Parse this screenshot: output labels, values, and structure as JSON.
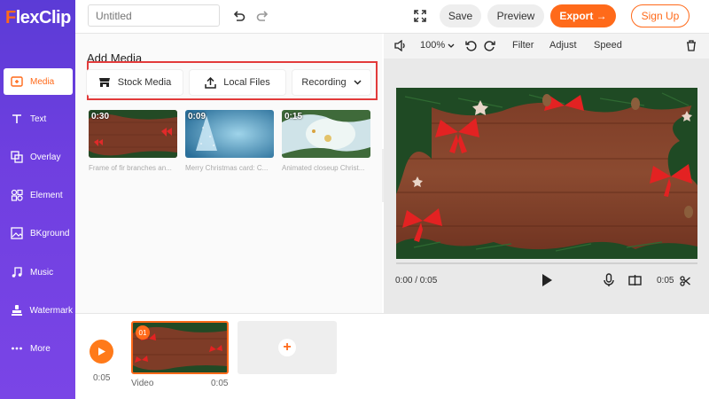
{
  "app": {
    "logo": "FlexClip"
  },
  "sidebar": {
    "items": [
      {
        "label": "Media",
        "icon": "media-icon",
        "active": true
      },
      {
        "label": "Text",
        "icon": "text-icon"
      },
      {
        "label": "Overlay",
        "icon": "overlay-icon"
      },
      {
        "label": "Element",
        "icon": "element-icon"
      },
      {
        "label": "BKground",
        "icon": "background-icon"
      },
      {
        "label": "Music",
        "icon": "music-icon"
      },
      {
        "label": "Watermark",
        "icon": "watermark-icon"
      },
      {
        "label": "More",
        "icon": "more-icon"
      }
    ]
  },
  "topbar": {
    "title_placeholder": "Untitled",
    "save": "Save",
    "preview": "Preview",
    "export": "Export →",
    "signup": "Sign Up"
  },
  "panel": {
    "title": "Add Media",
    "sources": {
      "stock": "Stock Media",
      "local": "Local Files",
      "recording": "Recording"
    },
    "thumbs": [
      {
        "duration": "0:30",
        "caption": "Frame of fir branches an..."
      },
      {
        "duration": "0:09",
        "caption": "Merry Christmas card: C..."
      },
      {
        "duration": "0:15",
        "caption": "Animated closeup Christ..."
      }
    ]
  },
  "preview": {
    "zoom": "100%",
    "filter": "Filter",
    "adjust": "Adjust",
    "speed": "Speed",
    "time_current": "0:00 / 0:05",
    "duration": "0:05"
  },
  "timeline": {
    "total_time": "0:05",
    "clip_number": "01",
    "clip_label": "Video",
    "clip_duration": "0:05"
  },
  "colors": {
    "accent": "#ff6a1a",
    "sidebar": "#6a3fe0",
    "highlight": "#e23b3b"
  }
}
